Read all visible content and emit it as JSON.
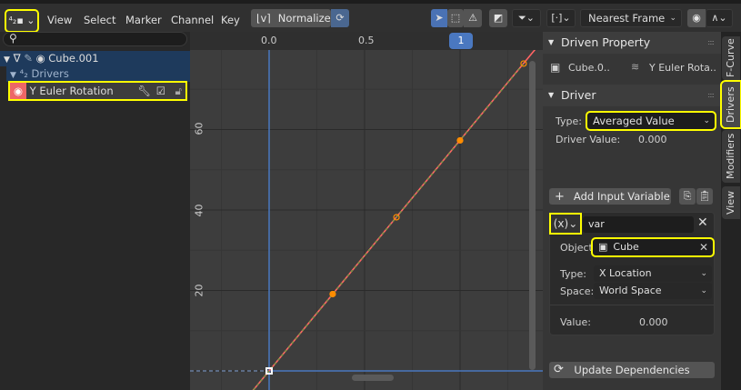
{
  "header": {
    "editor_type_icon": "drivers-editor-icon",
    "menus": [
      "View",
      "Select",
      "Marker",
      "Channel",
      "Key"
    ],
    "normalize_label": "Normalize",
    "snapping": "Nearest Frame"
  },
  "channels": {
    "search_placeholder": "",
    "object": "Cube.001",
    "group": "Drivers",
    "fcurve": "Y Euler Rotation"
  },
  "graph": {
    "x_ticks": [
      "0.0",
      "0.5",
      "1"
    ],
    "y_ticks": [
      "20",
      "40",
      "60"
    ],
    "current_frame": "1",
    "keyframes": [
      {
        "x": 0,
        "y": 0
      },
      {
        "x": 0.333,
        "y": 19.1
      },
      {
        "x": 0.667,
        "y": 38.2
      },
      {
        "x": 1.0,
        "y": 57.3
      },
      {
        "x": 1.333,
        "y": 76.4
      }
    ],
    "colors": {
      "curve": "#ff6464",
      "driver_line": "#5aaa3c",
      "cursor": "#4a78c0",
      "keyframe": "#ff8c00"
    }
  },
  "sidebar": {
    "tabs": [
      "F-Curve",
      "Drivers",
      "Modifiers",
      "View"
    ],
    "driven_property": {
      "title": "Driven Property",
      "object": "Cube.0..",
      "property": "Y Euler Rota.."
    },
    "driver": {
      "title": "Driver",
      "type_label": "Type:",
      "type_value": "Averaged Value",
      "value_label": "Driver Value:",
      "value": "0.000",
      "add_variable": "Add Input Variable",
      "variable": {
        "type_icon": "(x)",
        "name": "var",
        "object_label": "Object",
        "object": "Cube",
        "type_label": "Type:",
        "type_value": "X Location",
        "space_label": "Space:",
        "space_value": "World Space",
        "value_label": "Value:",
        "value": "0.000"
      },
      "update": "Update Dependencies"
    }
  }
}
